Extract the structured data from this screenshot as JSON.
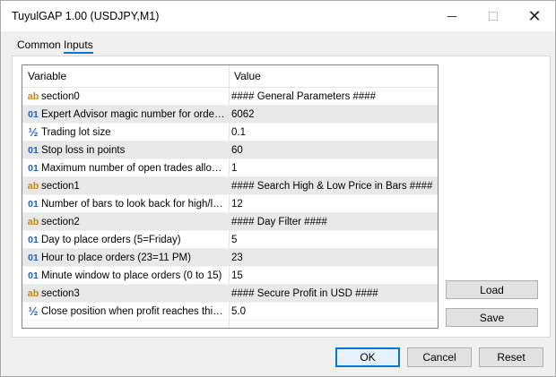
{
  "window": {
    "title": "TuyulGAP 1.00 (USDJPY,M1)",
    "controls": {
      "minimize": "minimize-icon",
      "maximize": "maximize-icon",
      "close": "close-icon"
    }
  },
  "tabs": [
    {
      "label": "Common",
      "active": false
    },
    {
      "label": "Inputs",
      "active": true
    }
  ],
  "grid": {
    "columns": {
      "variable": "Variable",
      "value": "Value"
    },
    "rows": [
      {
        "icon": "ab",
        "variable": "section0",
        "value": "#### General Parameters ####"
      },
      {
        "icon": "01",
        "variable": "Expert Advisor magic number for order i...",
        "value": "6062"
      },
      {
        "icon": "½",
        "variable": "Trading lot size",
        "value": "0.1"
      },
      {
        "icon": "01",
        "variable": "Stop loss in points",
        "value": "60"
      },
      {
        "icon": "01",
        "variable": "Maximum number of open trades allowed",
        "value": "1"
      },
      {
        "icon": "ab",
        "variable": "section1",
        "value": "#### Search High & Low Price in Bars ####"
      },
      {
        "icon": "01",
        "variable": "Number of bars to look back for high/lo...",
        "value": "12"
      },
      {
        "icon": "ab",
        "variable": "section2",
        "value": "#### Day Filter ####"
      },
      {
        "icon": "01",
        "variable": "Day to place orders (5=Friday)",
        "value": "5"
      },
      {
        "icon": "01",
        "variable": "Hour to place orders (23=11 PM)",
        "value": "23"
      },
      {
        "icon": "01",
        "variable": "Minute window to place orders (0 to 15)",
        "value": "15"
      },
      {
        "icon": "ab",
        "variable": "section3",
        "value": "#### Secure Profit in USD ####"
      },
      {
        "icon": "½",
        "variable": "Close position when profit reaches this ...",
        "value": "5.0"
      }
    ]
  },
  "side_buttons": {
    "load": "Load",
    "save": "Save"
  },
  "footer_buttons": {
    "ok": "OK",
    "cancel": "Cancel",
    "reset": "Reset"
  },
  "colors": {
    "accent": "#0078d7",
    "string_icon": "#c28a1a",
    "number_icon": "#1f5fbf",
    "alt_row": "#e8e8e8"
  }
}
